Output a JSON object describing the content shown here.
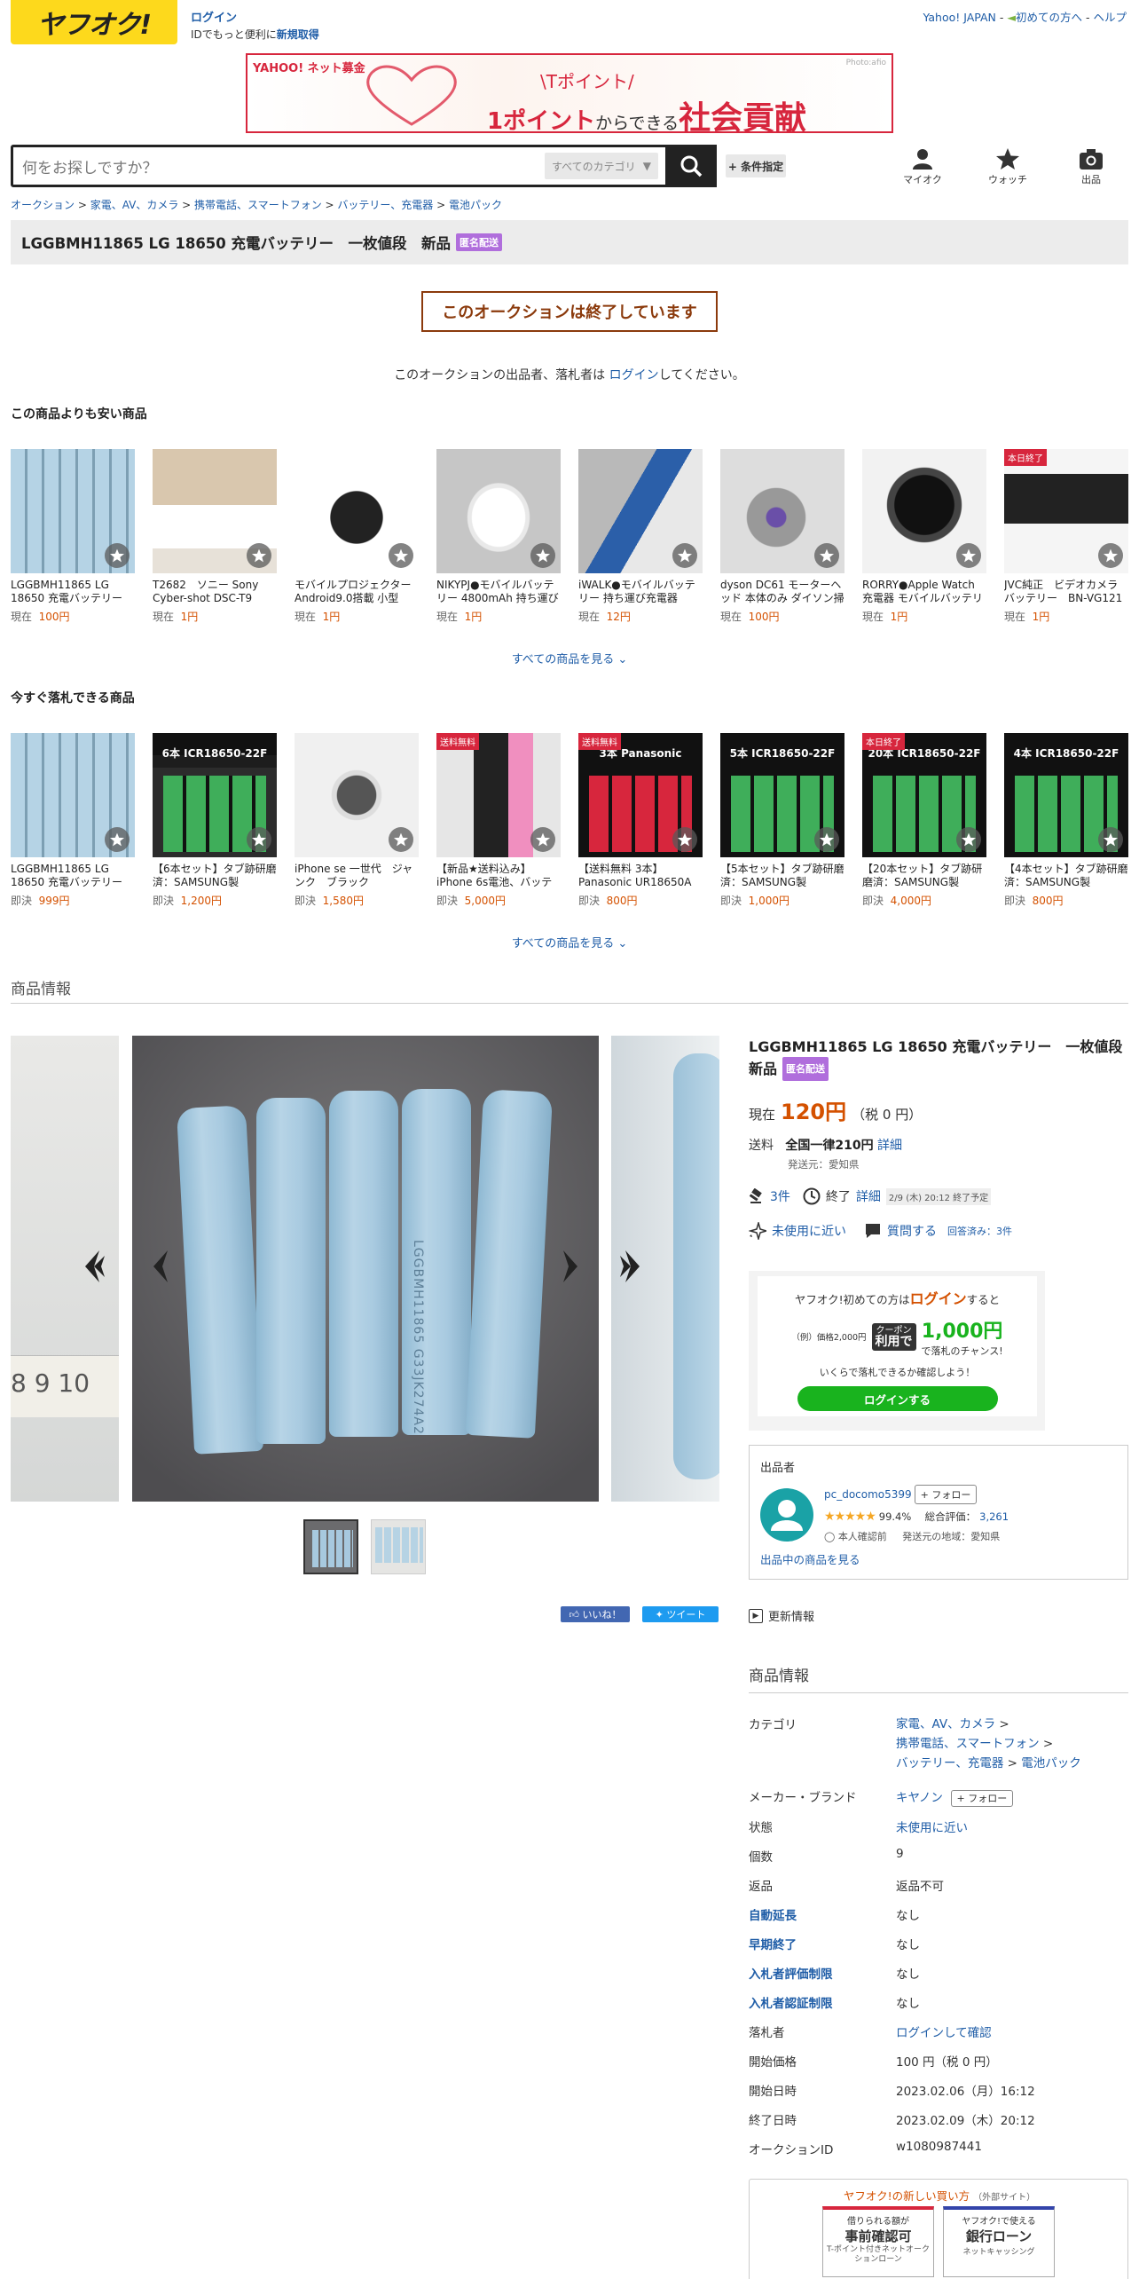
{
  "header": {
    "logo": "ヤフオク!",
    "login_link": "ログイン",
    "login_sub_prefix": "IDでもっと便利に",
    "signup_link": "新規取得",
    "right_links": [
      "Yahoo! JAPAN",
      "初めての方へ",
      "ヘルプ"
    ]
  },
  "banner": {
    "brand": "YAHOO! ネット募金",
    "line1": "\\Tポイント/",
    "line2_a": "1ポイント",
    "line2_b": "からできる",
    "line2_c": "社会貢献",
    "credit": "Photo:afio"
  },
  "search": {
    "placeholder": "何をお探しですか？",
    "category": "すべてのカテゴリ",
    "conditions": "+ 条件指定",
    "icons": [
      {
        "label": "マイオク",
        "icon": "person-icon"
      },
      {
        "label": "ウォッチ",
        "icon": "star-icon"
      },
      {
        "label": "出品",
        "icon": "camera-icon"
      }
    ]
  },
  "breadcrumb": [
    "オークション",
    "家電、AV、カメラ",
    "携帯電話、スマートフォン",
    "バッテリー、充電器",
    "電池パック"
  ],
  "title": "LGGBMH11865 LG 18650 充電バッテリー　一枚値段　新品",
  "anon_badge": "匿名配送",
  "ended_notice": "このオークションは終了しています",
  "ended_message": {
    "before": "このオークションの出品者、落札者は ",
    "link": "ログイン",
    "after": "してください。"
  },
  "cheaper": {
    "heading": "この商品よりも安い商品",
    "more": "すべての商品を見る",
    "items": [
      {
        "name": "LGGBMH11865 LG 18650 充電バッテリー　一枚...",
        "price_prefix": "現在",
        "price": "100円",
        "tag": ""
      },
      {
        "name": "T2682　ソニー Sony Cyber-shot DSC-T9 Optical Steady...",
        "price_prefix": "現在",
        "price": "1円",
        "tag": ""
      },
      {
        "name": "モバイルプロジェクター Android9.0搭載 小型 1080...",
        "price_prefix": "現在",
        "price": "1円",
        "tag": ""
      },
      {
        "name": "NIKYPJ●モバイルバッテリー 4800mAh 持ち運び充電器...",
        "price_prefix": "現在",
        "price": "1円",
        "tag": ""
      },
      {
        "name": "iWALK●モバイルバッテリー 持ち運び充電器 4500m...",
        "price_prefix": "現在",
        "price": "12円",
        "tag": ""
      },
      {
        "name": "dyson DC61 モーターヘッド 本体のみ ダイソン掃除...",
        "price_prefix": "現在",
        "price": "100円",
        "tag": ""
      },
      {
        "name": "RORRY●Apple Watch 充電器 モバイルバッテリー 5200...",
        "price_prefix": "現在",
        "price": "1円",
        "tag": ""
      },
      {
        "name": "JVC純正　ビデオカメラ バッテリー　BN-VG121 ...",
        "price_prefix": "現在",
        "price": "1円",
        "tag": "本日終了"
      }
    ]
  },
  "buynow": {
    "heading": "今すぐ落札できる商品",
    "more": "すべての商品を見る",
    "items": [
      {
        "name": "LGGBMH11865 LG 18650 充電バッテリー　一枚値段...",
        "price_prefix": "即決",
        "price": "999円",
        "tag": "",
        "overlay": ""
      },
      {
        "name": "【6本セット】タブ跡研磨済：SAMSUNG製 ICR18650...",
        "price_prefix": "即決",
        "price": "1,200円",
        "tag": "",
        "overlay": "6本 ICR18650-22F"
      },
      {
        "name": "iPhone se 一世代　ジャンク　ブラック",
        "price_prefix": "即決",
        "price": "1,580円",
        "tag": "",
        "overlay": ""
      },
      {
        "name": "【新品★送料込み】iPhone 6s電池、バッテリー ...",
        "price_prefix": "即決",
        "price": "5,000円",
        "tag": "送料無料",
        "overlay": ""
      },
      {
        "name": "【送料無料 3本】Panasonic UR18650A 18650リチウム...",
        "price_prefix": "即決",
        "price": "800円",
        "tag": "送料無料",
        "overlay": "3本 Panasonic"
      },
      {
        "name": "【5本セット】タブ跡研磨済：SAMSUNG製 ICR18650...",
        "price_prefix": "即決",
        "price": "1,000円",
        "tag": "",
        "overlay": "5本 ICR18650-22F"
      },
      {
        "name": "【20本セット】タブ跡研磨済：SAMSUNG製 ICR1865...",
        "price_prefix": "即決",
        "price": "4,000円",
        "tag": "本日終了",
        "overlay": "20本 ICR18650-22F"
      },
      {
        "name": "【4本セット】タブ跡研磨済：SAMSUNG製 ICR18650...",
        "price_prefix": "即決",
        "price": "800円",
        "tag": "",
        "overlay": "4本 ICR18650-22F"
      }
    ]
  },
  "info_heading": "商品情報",
  "gallery": {
    "battery_text": "LGGBMH11865 G33JK274A2",
    "tape_text": "8 9 10"
  },
  "social": {
    "like": "いいね！",
    "tweet": "ツイート"
  },
  "summary": {
    "price_label": "現在",
    "price": "120円",
    "price_tax": "（税 0 円）",
    "ship_label": "送料",
    "ship_value": "全国一律210円",
    "ship_detail": "詳細",
    "ship_from": "発送元：愛知県",
    "bids": "3件",
    "end_label": "終了",
    "end_detail": "詳細",
    "end_time": "2/9 (木) 20:12 終了予定",
    "condition": "未使用に近い",
    "question": "質問する",
    "answered": "回答済み：3件"
  },
  "promo": {
    "line1_a": "ヤフオク!初めての方は",
    "line1_b": "ログイン",
    "line1_c": "すると",
    "example": "（例）価格2,000円",
    "coupon_a": "クーポン",
    "coupon_b": "利用で",
    "amount": "1,000円",
    "chance": "で落札のチャンス!",
    "check": "いくらで落札できるか確認しよう！",
    "button": "ログインする"
  },
  "seller": {
    "heading": "出品者",
    "name": "pc_docomo5399",
    "follow": "+ フォロー",
    "rating_pct": "99.4%",
    "rating_label": "総合評価：",
    "rating_count": "3,261",
    "verified": "本人確認前",
    "region": "発送元の地域：愛知県",
    "listings": "出品中の商品を見る",
    "stars": 5
  },
  "update_label": "更新情報",
  "specs": {
    "heading": "商品情報",
    "category_label": "カテゴリ",
    "category": [
      "家電、AV、カメラ",
      "携帯電話、スマートフォン",
      "バッテリー、充電器",
      "電池パック"
    ],
    "maker_label": "メーカー・ブランド",
    "maker": "キヤノン",
    "maker_follow": "+ フォロー",
    "rows": [
      {
        "k": "状態",
        "v": "未使用に近い",
        "kblue": false,
        "vlink": true
      },
      {
        "k": "個数",
        "v": "9",
        "kblue": false,
        "vlink": false
      },
      {
        "k": "返品",
        "v": "返品不可",
        "kblue": false,
        "vlink": false
      },
      {
        "k": "自動延長",
        "v": "なし",
        "kblue": true,
        "vlink": false
      },
      {
        "k": "早期終了",
        "v": "なし",
        "kblue": true,
        "vlink": false
      },
      {
        "k": "入札者評価制限",
        "v": "なし",
        "kblue": true,
        "vlink": false
      },
      {
        "k": "入札者認証制限",
        "v": "なし",
        "kblue": true,
        "vlink": false
      },
      {
        "k": "落札者",
        "v": "ログインして確認",
        "kblue": false,
        "vlink": true
      },
      {
        "k": "開始価格",
        "v": "100 円（税 0 円）",
        "kblue": false,
        "vlink": false
      },
      {
        "k": "開始日時",
        "v": "2023.02.06（月）16:12",
        "kblue": false,
        "vlink": false
      },
      {
        "k": "終了日時",
        "v": "2023.02.09（木）20:12",
        "kblue": false,
        "vlink": false
      },
      {
        "k": "オークションID",
        "v": "w1080987441",
        "kblue": false,
        "vlink": false
      }
    ]
  },
  "newbuy": {
    "heading": "ヤフオク!の新しい買い方",
    "external": "（外部サイト）",
    "card1_top": "借りられる額が",
    "card1_main": "事前確認可",
    "card1_sub": "T-ポイント付きネットオークションローン",
    "card2_top": "ヤフオク!で使える",
    "card2_main": "銀行ローン",
    "card2_sub": "ネットキャッシング"
  },
  "colors": {
    "accent": "#fdd91c",
    "link": "#1f5da7",
    "price": "#d45100",
    "ended": "#8b3a0c",
    "anon": "#b06edc",
    "login_btn": "#19b31e"
  }
}
